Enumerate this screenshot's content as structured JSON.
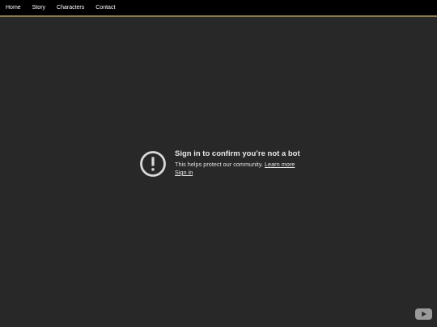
{
  "nav": {
    "items": [
      {
        "label": "Home"
      },
      {
        "label": "Story"
      },
      {
        "label": "Characters"
      },
      {
        "label": "Contact"
      }
    ]
  },
  "notice": {
    "icon": "exclamation-circle-icon",
    "title": "Sign in to confirm you’re not a bot",
    "message": "This helps protect our community.",
    "learn_more": "Learn more",
    "sign_in": "Sign in"
  },
  "player": {
    "logo_icon": "youtube-play-icon"
  },
  "colors": {
    "nav_bg": "#000000",
    "nav_border": "#8a7a4f",
    "page_bg": "#282828",
    "text": "#e6e6e6"
  }
}
